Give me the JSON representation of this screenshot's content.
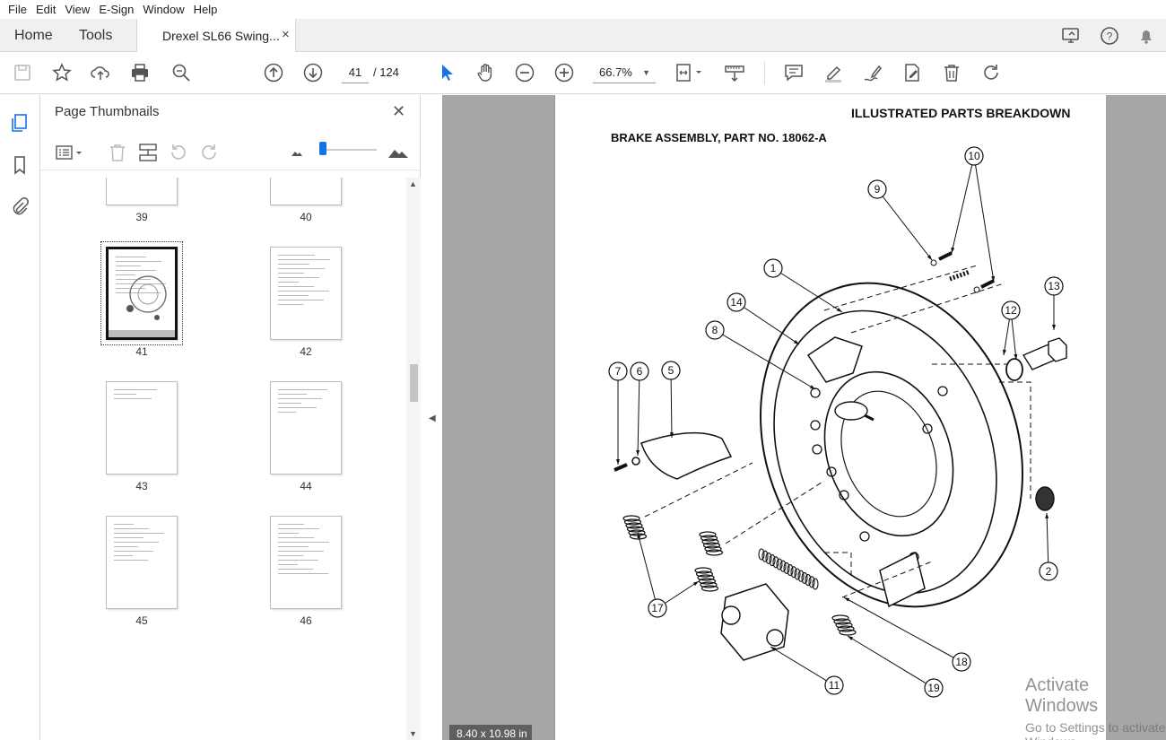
{
  "menu": [
    "File",
    "Edit",
    "View",
    "E-Sign",
    "Window",
    "Help"
  ],
  "tabs": {
    "home": "Home",
    "tools": "Tools",
    "document": "Drexel SL66 Swing...",
    "close": "×"
  },
  "toolbar": {
    "current_page": "41",
    "total_pages": "/ 124",
    "zoom": "66.7%",
    "zoom_caret": "▼"
  },
  "thumbnails": {
    "title": "Page Thumbnails",
    "close": "✕",
    "pages": [
      {
        "label": "39"
      },
      {
        "label": "40"
      },
      {
        "label": "41",
        "selected": true
      },
      {
        "label": "42"
      },
      {
        "label": "43"
      },
      {
        "label": "44"
      },
      {
        "label": "45"
      },
      {
        "label": "46"
      }
    ]
  },
  "document": {
    "header": "ILLUSTRATED PARTS BREAKDOWN",
    "subtitle": "BRAKE ASSEMBLY, PART NO. 18062-A",
    "callouts": [
      "10",
      "9",
      "1",
      "13",
      "14",
      "12",
      "8",
      "7",
      "6",
      "5",
      "2",
      "17",
      "18",
      "11",
      "19"
    ],
    "page_size": "8.40 x 10.98 in"
  },
  "watermark": {
    "line1": "Activate Windows",
    "line2": "Go to Settings to activate Windows."
  },
  "colors": {
    "accent": "#1473e6",
    "doc_bg": "#a6a6a6",
    "tab_bar": "#f0f0f0"
  }
}
